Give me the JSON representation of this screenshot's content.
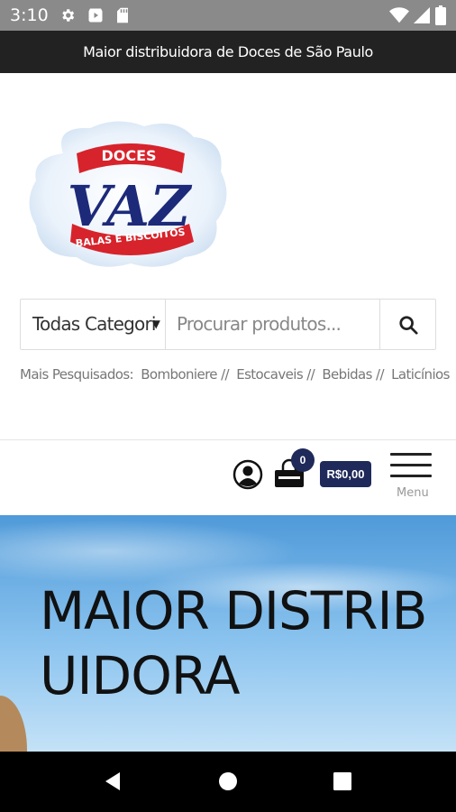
{
  "status_bar": {
    "time": "3:10"
  },
  "top_banner": {
    "text": "Maior distribuidora de Doces de São Paulo"
  },
  "logo": {
    "top_text": "DOCES",
    "main_text": "VAZ",
    "bottom_text": "BALAS E BISCOITOS",
    "colors": {
      "red": "#d7232b",
      "blue": "#1d2a7a"
    }
  },
  "search": {
    "category_label": "Todas Categori",
    "placeholder": "Procurar produtos..."
  },
  "popular": {
    "label": "Mais Pesquisados:",
    "items": [
      "Bomboniere //",
      "Estocaveis //",
      "Bebidas //",
      "Laticínios"
    ]
  },
  "header_actions": {
    "cart_count": "0",
    "cart_total": "R$0,00",
    "menu_label": "Menu"
  },
  "hero": {
    "title": "MAIOR DISTRIBUIDORA"
  },
  "colors": {
    "navy": "#1f2a5a",
    "topbar": "#222222",
    "statusbar": "#8a8a8a"
  }
}
